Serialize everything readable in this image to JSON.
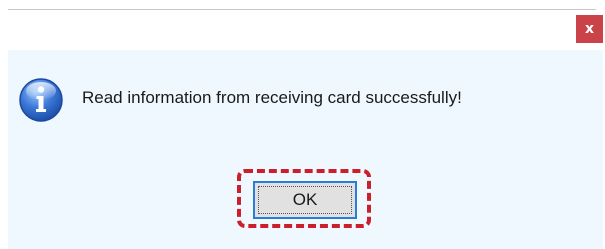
{
  "dialog": {
    "close_label": "x",
    "message": "Read information from receiving card successfully!",
    "icon": "info-icon",
    "ok_label": "OK",
    "colors": {
      "close_bg": "#c94348",
      "body_bg": "#f0f8ff",
      "button_border": "#2a7dd6",
      "highlight": "#cc1f2c"
    }
  }
}
